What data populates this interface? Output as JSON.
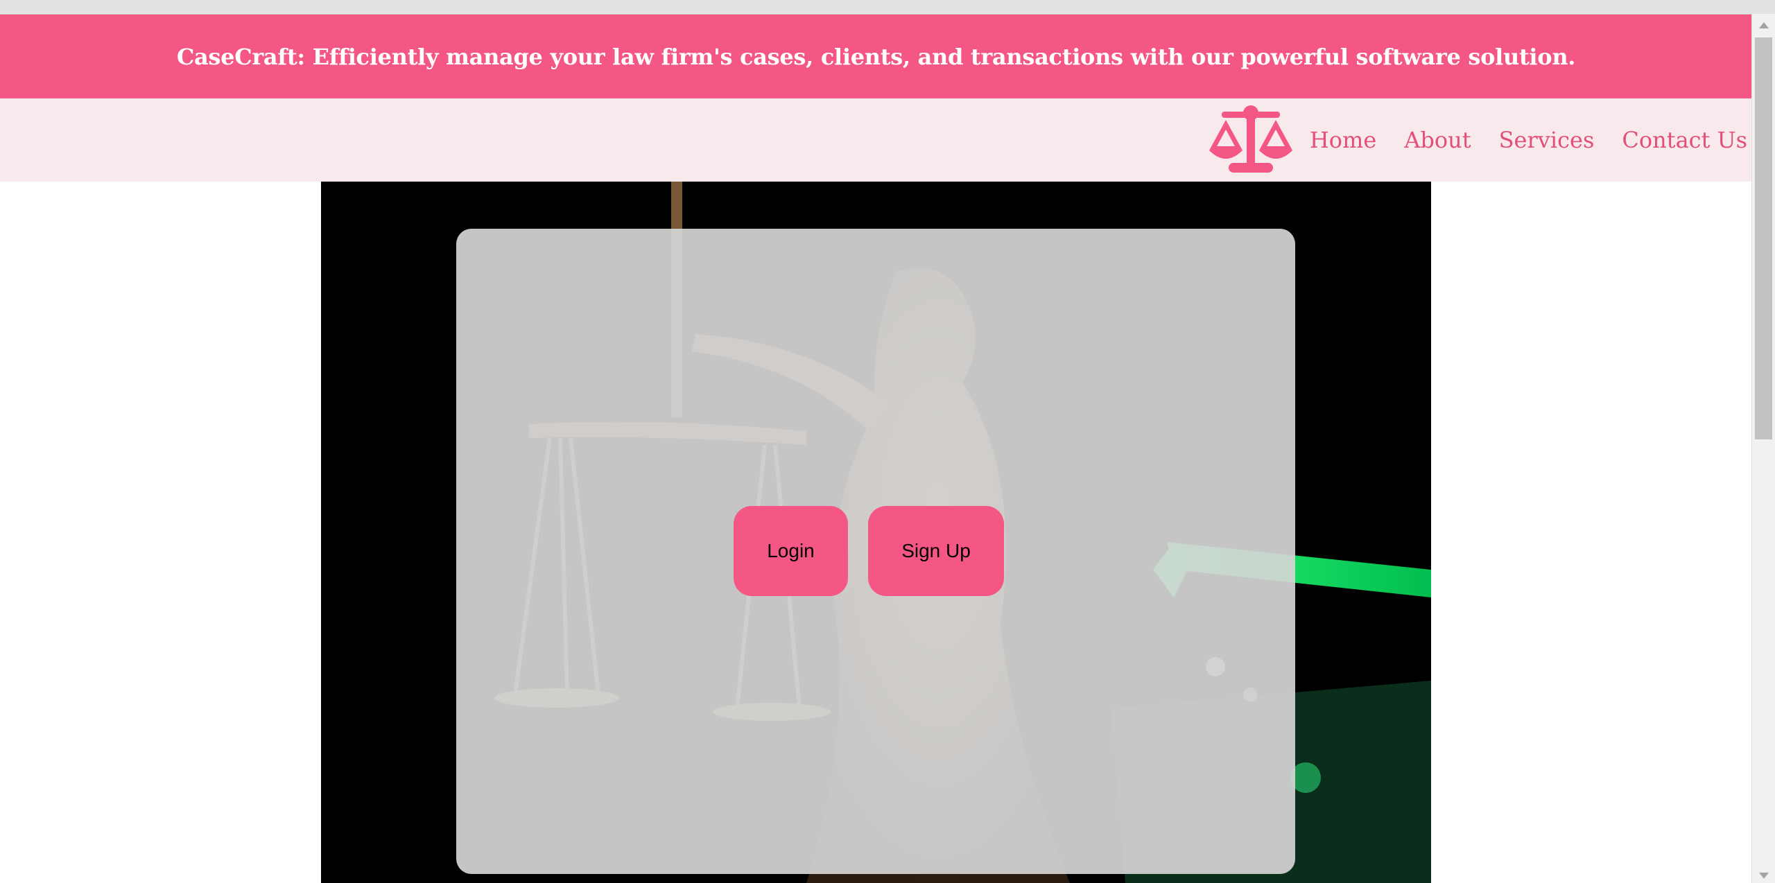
{
  "banner": {
    "text": "CaseCraft: Efficiently manage your law firm's cases, clients, and transactions with our powerful software solution."
  },
  "navbar": {
    "logo_icon": "scales-of-justice-icon",
    "links": [
      {
        "label": "Home"
      },
      {
        "label": "About"
      },
      {
        "label": "Services"
      },
      {
        "label": "Contact Us"
      }
    ]
  },
  "hero": {
    "image": "lady-justice-statue-photo",
    "buttons": {
      "login_label": "Login",
      "signup_label": "Sign Up"
    }
  },
  "colors": {
    "brand": "#f55784",
    "nav_background": "#f8eaec",
    "nav_link": "#e34f7a",
    "panel": "#d6d6d6"
  }
}
